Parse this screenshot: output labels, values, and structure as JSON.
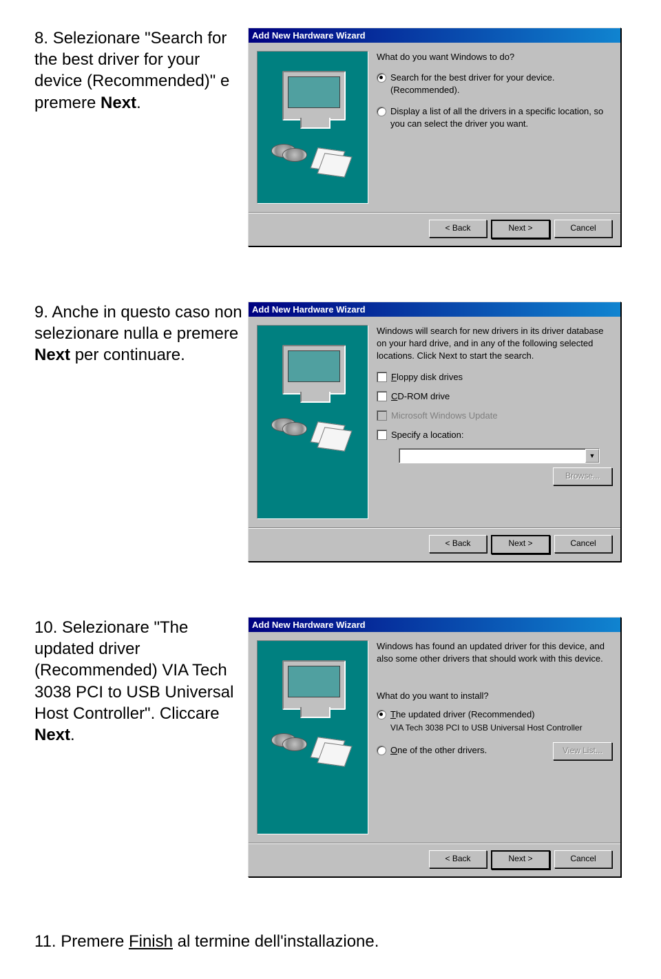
{
  "steps": {
    "s8": {
      "num": "8.",
      "before": "Selezionare \"Search for the best driver for your device (Recommended)\" e premere ",
      "bold": "Next",
      "after": "."
    },
    "s9": {
      "num": "9.",
      "before": "Anche in questo caso non selezionare nulla e premere ",
      "bold": "Next",
      "after": " per continuare."
    },
    "s10": {
      "num": "10.",
      "before": "Selezionare \"The updated driver (Recommended) VIA Tech 3038 PCI to USB Universal Host Controller\". Cliccare ",
      "bold": "Next",
      "after": "."
    },
    "s11": {
      "num": "11.",
      "before": "Premere ",
      "bold": "Finish",
      "after": " al termine dell'installazione."
    }
  },
  "wizard": {
    "title": "Add New Hardware Wizard",
    "buttons": {
      "back": "< Back",
      "next": "Next >",
      "cancel": "Cancel",
      "browse": "Browse...",
      "viewlist": "View List..."
    },
    "w1": {
      "question": "What do you want Windows to do?",
      "opt1a": "Search for the best driver for your device.",
      "opt1b": "(Recommended).",
      "opt2": "Display a list of all the drivers in a specific location, so you can select the driver you want."
    },
    "w2": {
      "intro": "Windows will search for new drivers in its driver database on your hard drive, and in any of the following selected locations. Click Next to start the search.",
      "opt_floppy": "Floppy disk drives",
      "opt_cd": "CD-ROM drive",
      "opt_wu": "Microsoft Windows Update",
      "opt_spec": "Specify a location:"
    },
    "w3": {
      "intro": "Windows has found an updated driver for this device, and also some other drivers that should work with this device.",
      "question": "What do you want to install?",
      "opt1a": "The updated driver (Recommended)",
      "opt1b": "VIA Tech 3038 PCI to USB Universal Host Controller",
      "opt2": "One of the other drivers."
    }
  }
}
